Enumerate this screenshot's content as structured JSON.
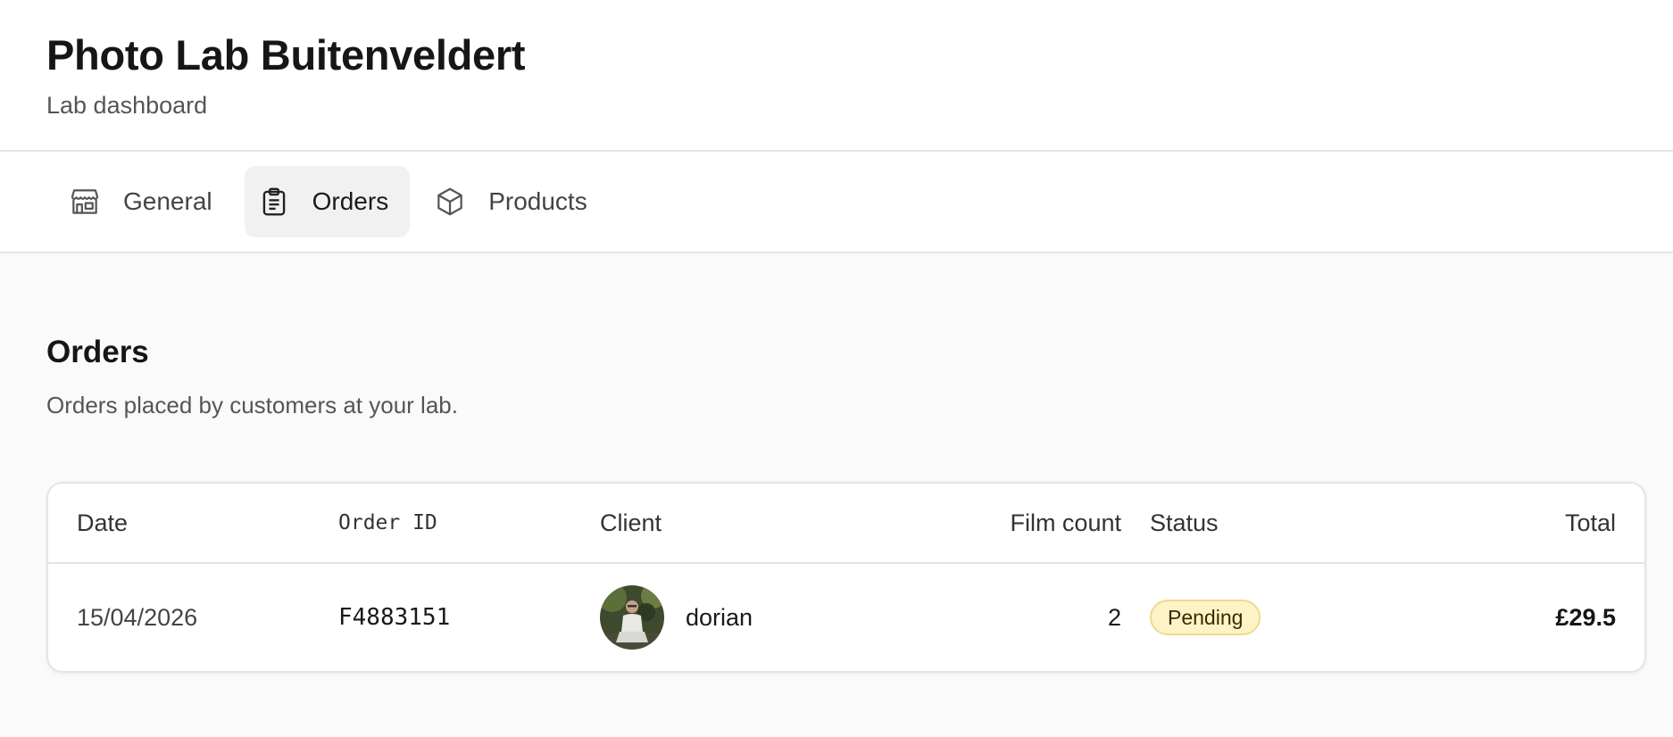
{
  "header": {
    "title": "Photo Lab Buitenveldert",
    "subtitle": "Lab dashboard"
  },
  "tabs": [
    {
      "label": "General",
      "icon": "storefront-icon",
      "active": false
    },
    {
      "label": "Orders",
      "icon": "clipboard-icon",
      "active": true
    },
    {
      "label": "Products",
      "icon": "box-icon",
      "active": false
    }
  ],
  "orders": {
    "title": "Orders",
    "description": "Orders placed by customers at your lab.",
    "columns": {
      "date": "Date",
      "order_id": "Order ID",
      "client": "Client",
      "film_count": "Film count",
      "status": "Status",
      "total": "Total"
    },
    "rows": [
      {
        "date": "15/04/2026",
        "order_id": "F4883151",
        "client": "dorian",
        "film_count": "2",
        "status": "Pending",
        "total": "£29.5"
      }
    ]
  },
  "colors": {
    "badge_bg": "#fdf3c6",
    "badge_border": "#f0d98a",
    "active_tab_bg": "#f1f1f1"
  }
}
